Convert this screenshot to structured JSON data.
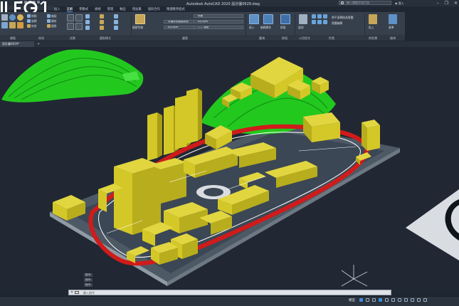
{
  "app": {
    "title": "Autodesk AutoCAD 2020   設計圖0629.dwg",
    "logo_text": "ILEG1"
  },
  "search": {
    "placeholder": "鍵入關鍵字或片語"
  },
  "user": {
    "label": "登入"
  },
  "tabs": [
    "插入",
    "註解",
    "參數式",
    "檢視",
    "管理",
    "輸出",
    "增益集",
    "協同合作",
    "精選應用程式"
  ],
  "active_tab_index": 1,
  "ribbon": {
    "draw_panel": {
      "label": "繪製",
      "buttons": [
        "移動",
        "旋轉",
        "修剪",
        "複製",
        "鏡射",
        "圓角",
        "拉伸",
        "比例",
        "陣列"
      ]
    },
    "modify_panel": {
      "label": "修改"
    },
    "annotation_panel": {
      "label": "註解"
    },
    "layers_panel": {
      "label": "圖層",
      "layer_combo": "地面",
      "layer_state_combo": "未儲存的圖層狀態",
      "match_label": "圖層性質"
    },
    "block_panel": {
      "label": "圖塊",
      "insert_label": "插入",
      "edit_label": "編輯屬性"
    },
    "properties_panel": {
      "label": "性質",
      "color_combo": "ByLayer",
      "linetype_combo": "ByLayer",
      "lineweight_combo": "—— 預設",
      "match_label": "複製性質"
    },
    "groups_panel": {
      "label": "群組",
      "group_label": "群組"
    },
    "utilities_panel": {
      "label": "公用程式",
      "measure_label": "量測"
    },
    "clipboard_panel": {
      "label": "剪貼簿",
      "paste_label": "貼上"
    },
    "view_panel": {
      "label": "檢視",
      "base_label": "基準"
    },
    "extra_labels": [
      "選取模式",
      "建立",
      "修改",
      "將平面轉換為實體",
      "實體編輯"
    ]
  },
  "file_tab": {
    "label": "設計圖0629*"
  },
  "command": {
    "history": [
      "指令:",
      "指令:",
      "指令:"
    ],
    "placeholder": "鍵入指令"
  },
  "status": {
    "model_label": "模型"
  },
  "colors": {
    "background": "#212833",
    "buildings": "#d4c828",
    "terrain": "#23c81f",
    "road": "#d01b1b",
    "base": "#8f9aa4",
    "accent": "#3d8ede"
  }
}
